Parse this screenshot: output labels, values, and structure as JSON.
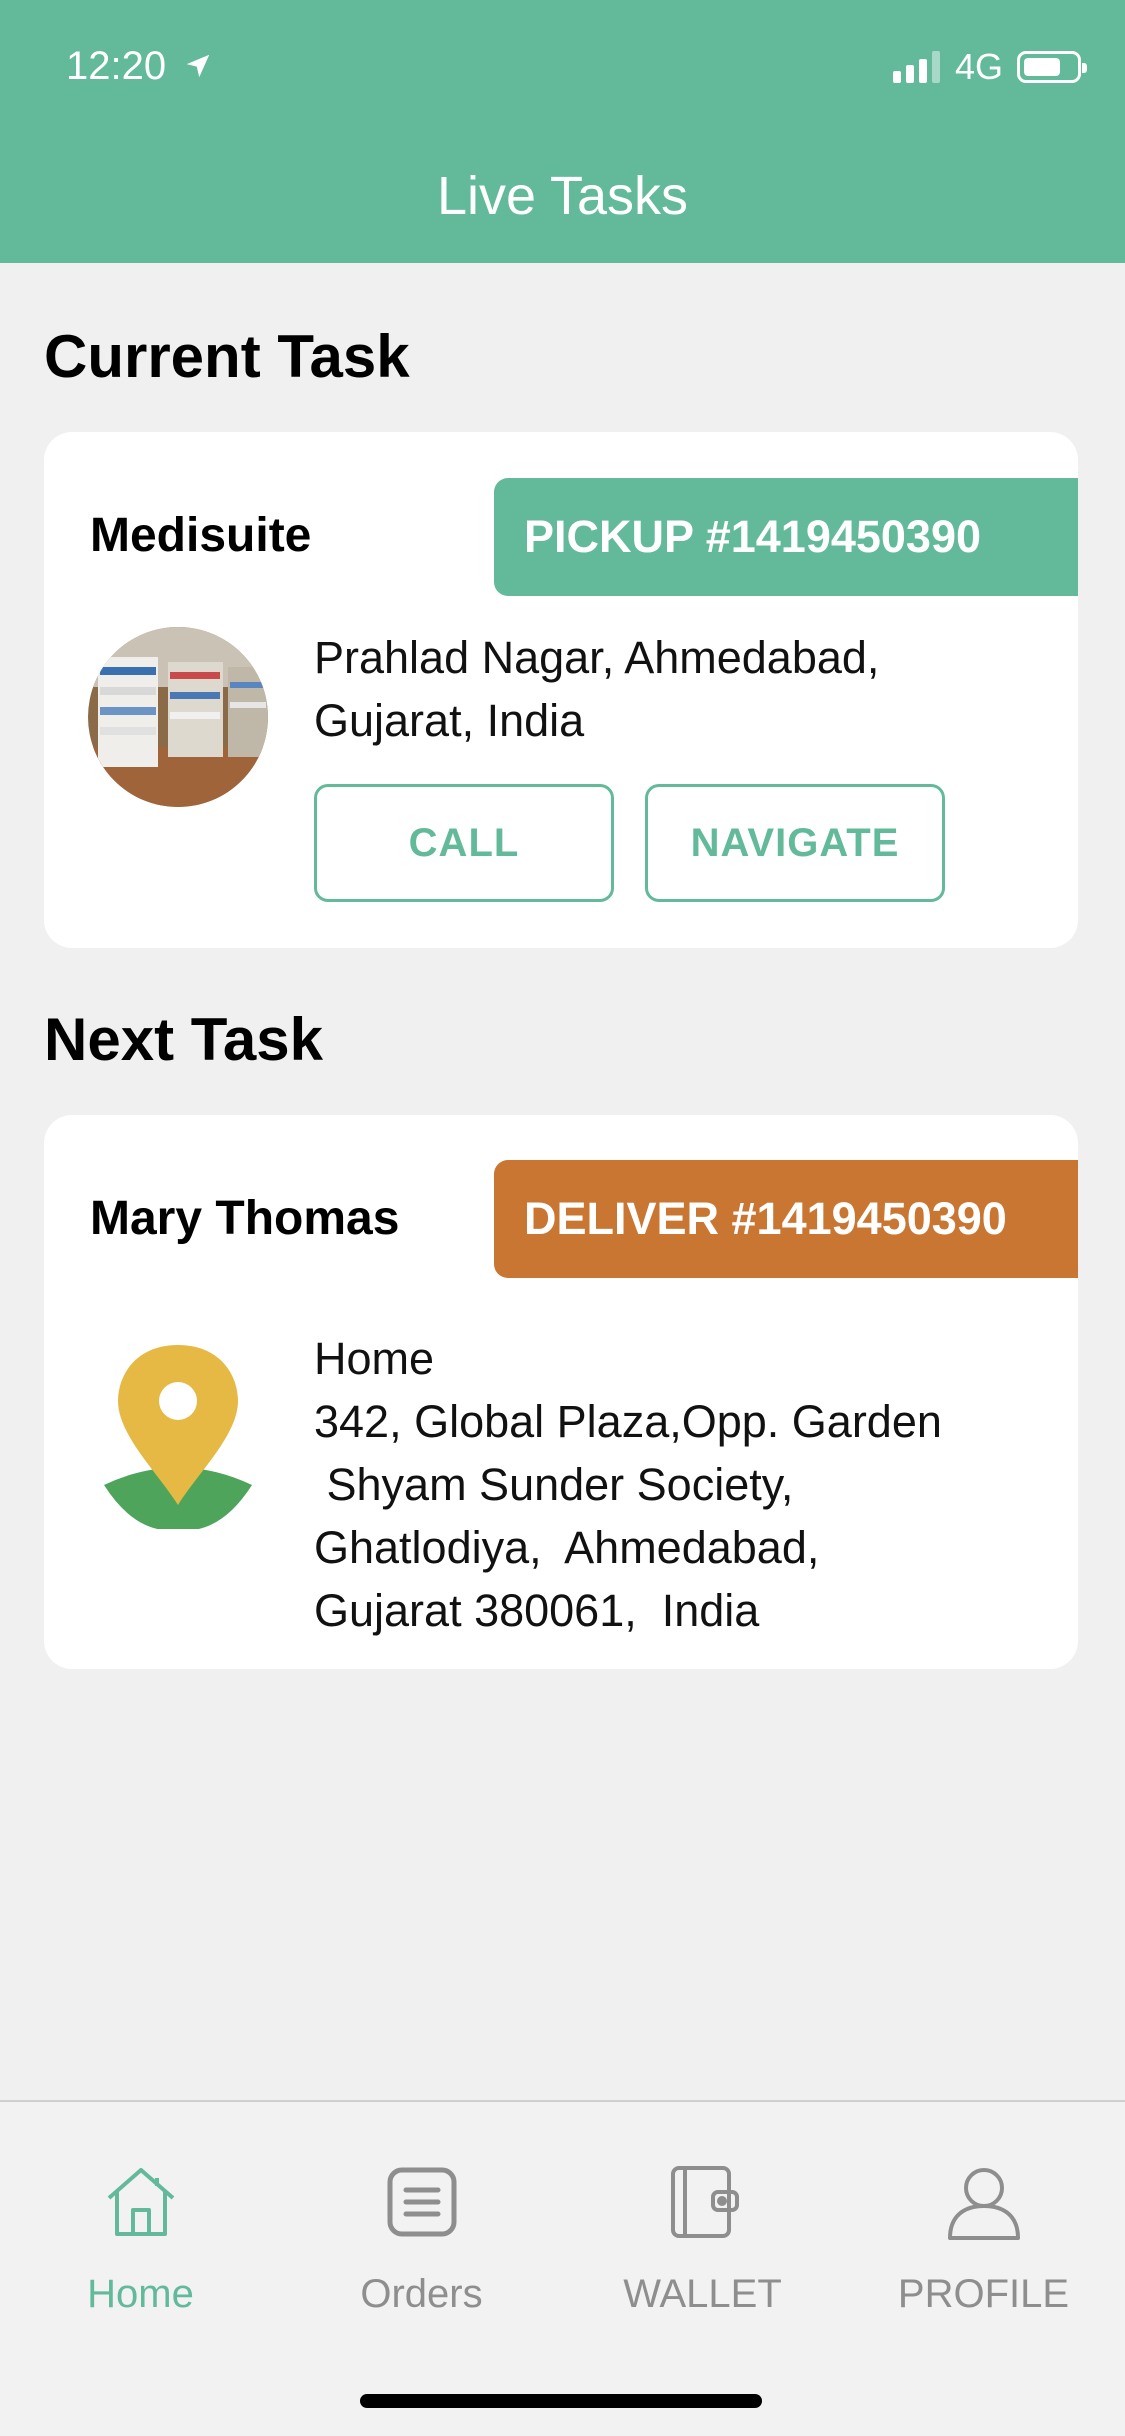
{
  "status_bar": {
    "time": "12:20",
    "network": "4G"
  },
  "header": {
    "title": "Live Tasks"
  },
  "current_task": {
    "section_title": "Current Task",
    "name": "Medisuite",
    "tag": "PICKUP #1419450390",
    "address": "Prahlad Nagar, Ahmedabad,\nGujarat, India",
    "call_label": "CALL",
    "navigate_label": "NAVIGATE"
  },
  "next_task": {
    "section_title": "Next Task",
    "name": "Mary Thomas",
    "tag": "DELIVER #1419450390",
    "address": "Home\n342, Global Plaza,Opp. Garden\n Shyam Sunder Society,\nGhatlodiya,  Ahmedabad,\nGujarat 380061,  India"
  },
  "nav": [
    {
      "label": "Home",
      "icon": "home-icon",
      "active": true
    },
    {
      "label": "Orders",
      "icon": "orders-icon",
      "active": false
    },
    {
      "label": "WALLET",
      "icon": "wallet-icon",
      "active": false
    },
    {
      "label": "PROFILE",
      "icon": "profile-icon",
      "active": false
    }
  ],
  "colors": {
    "primary": "#62ba9b",
    "deliver": "#c97632",
    "background": "#f0f0f0",
    "pin_yellow": "#e5b944",
    "pin_green": "#4ea45a"
  }
}
